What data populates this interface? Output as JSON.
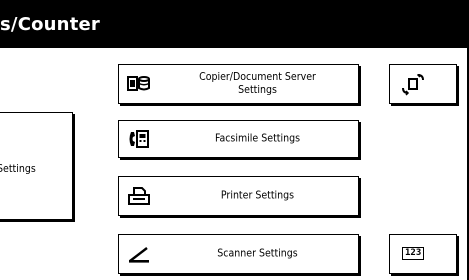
{
  "header": {
    "title": "s/Counter"
  },
  "buttons": {
    "copier": {
      "label_line1": "Copier/Document Server",
      "label_line2": "Settings"
    },
    "facsimile": {
      "label": "Facsimile Settings"
    },
    "printer": {
      "label": "Printer Settings"
    },
    "scanner": {
      "label": "Scanner Settings"
    },
    "left_settings": {
      "label": "Settings"
    },
    "counter_badge": "123"
  },
  "icons": {
    "copier": "copier-document-server-icon",
    "facsimile": "facsimile-icon",
    "printer": "printer-icon",
    "scanner": "scanner-icon",
    "transfer": "transfer-arrows-icon",
    "counter": "counter-icon"
  }
}
